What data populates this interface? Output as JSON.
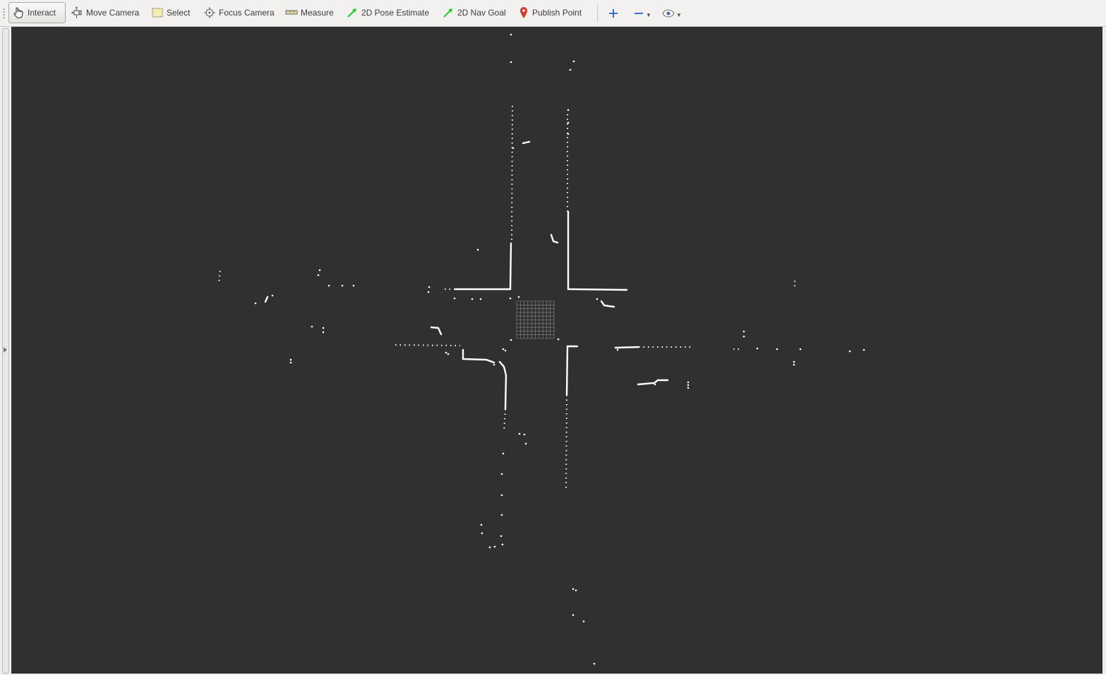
{
  "toolbar": {
    "tools": [
      {
        "label": "Interact",
        "icon": "hand-pointer-icon",
        "active": true
      },
      {
        "label": "Move Camera",
        "icon": "move-camera-icon"
      },
      {
        "label": "Select",
        "icon": "select-box-icon"
      },
      {
        "label": "Focus Camera",
        "icon": "focus-target-icon"
      },
      {
        "label": "Measure",
        "icon": "ruler-icon"
      },
      {
        "label": "2D Pose Estimate",
        "icon": "green-arrow-icon"
      },
      {
        "label": "2D Nav Goal",
        "icon": "green-arrow-icon"
      },
      {
        "label": "Publish Point",
        "icon": "map-pin-icon"
      }
    ],
    "extras": [
      "plus-icon",
      "minus-icon",
      "eye-icon"
    ]
  },
  "colors": {
    "viewport_bg": "#303030",
    "scan_points": "#ffffff",
    "grid": "#8a8a8a",
    "toolbar_bg": "#f2f1f0",
    "nav_arrow": "#22cc22",
    "pin": "#d23a2a",
    "plus": "#3a6fc8"
  }
}
